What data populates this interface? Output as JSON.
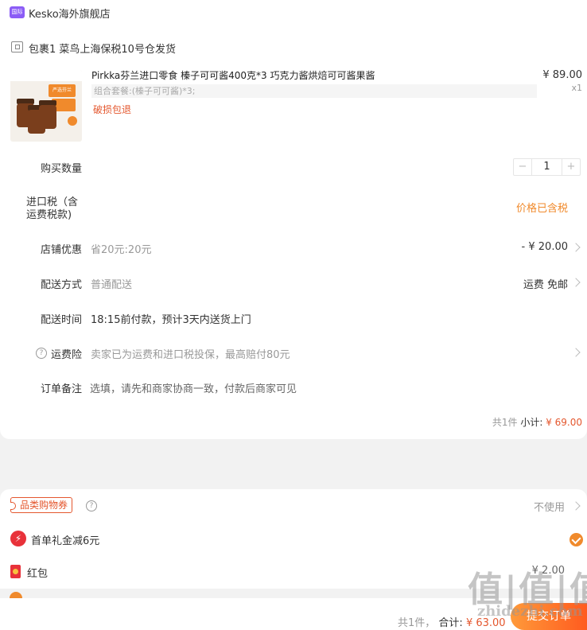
{
  "store": {
    "name": "Kesko海外旗舰店",
    "icon": "store-badge-icon",
    "badge_text": "国际"
  },
  "package": {
    "label": "包裹1 菜鸟上海保税10号仓发货"
  },
  "product": {
    "title": "Pirkka芬兰进口零食 榛子可可酱400克*3 巧克力酱烘焙可可酱果酱",
    "price": "¥ 89.00",
    "quantity_mark": "x1",
    "spec": "组合套餐:(榛子可可酱)*3;",
    "tag": "破损包退",
    "thumb_badge": "严选芬兰"
  },
  "rows": {
    "quantity": {
      "label": "购买数量",
      "value": "1",
      "minus": "−",
      "plus": "+"
    },
    "import_tax": {
      "label_line1": "进口税（含",
      "label_line2": "运费税款)",
      "value": "价格已含税"
    },
    "store_discount": {
      "label": "店铺优惠",
      "desc": "省20元:20元",
      "value": "- ¥ 20.00"
    },
    "delivery_method": {
      "label": "配送方式",
      "desc": "普通配送",
      "value": "运费 免邮"
    },
    "delivery_time": {
      "label": "配送时间",
      "desc": "18:15前付款，预计3天内送货上门"
    },
    "shipping_insurance": {
      "label": "运费险",
      "desc": "卖家已为运费和进口税投保，最高赔付80元",
      "help": "?"
    },
    "order_note": {
      "label": "订单备注",
      "placeholder": "选填，请先和商家协商一致，付款后商家可见"
    }
  },
  "subtotal": {
    "count": "共1件",
    "label": "小计:",
    "value": "¥ 69.00"
  },
  "coupons": {
    "category": {
      "label": "品类购物券",
      "value": "不使用",
      "help": "?"
    },
    "first_order": {
      "label": "首单礼金减6元"
    },
    "red_packet": {
      "label": "红包",
      "value": "¥ 2.00"
    }
  },
  "footer": {
    "count": "共1件，",
    "total_label": "合计:",
    "total_value": "¥ 63.00",
    "submit": "提交订单"
  },
  "watermark": {
    "text": "值|值|值",
    "sub": "zhidezhi.com"
  },
  "colors": {
    "accent": "#f08a2c",
    "price_red": "#e4572e",
    "muted": "#999999"
  }
}
